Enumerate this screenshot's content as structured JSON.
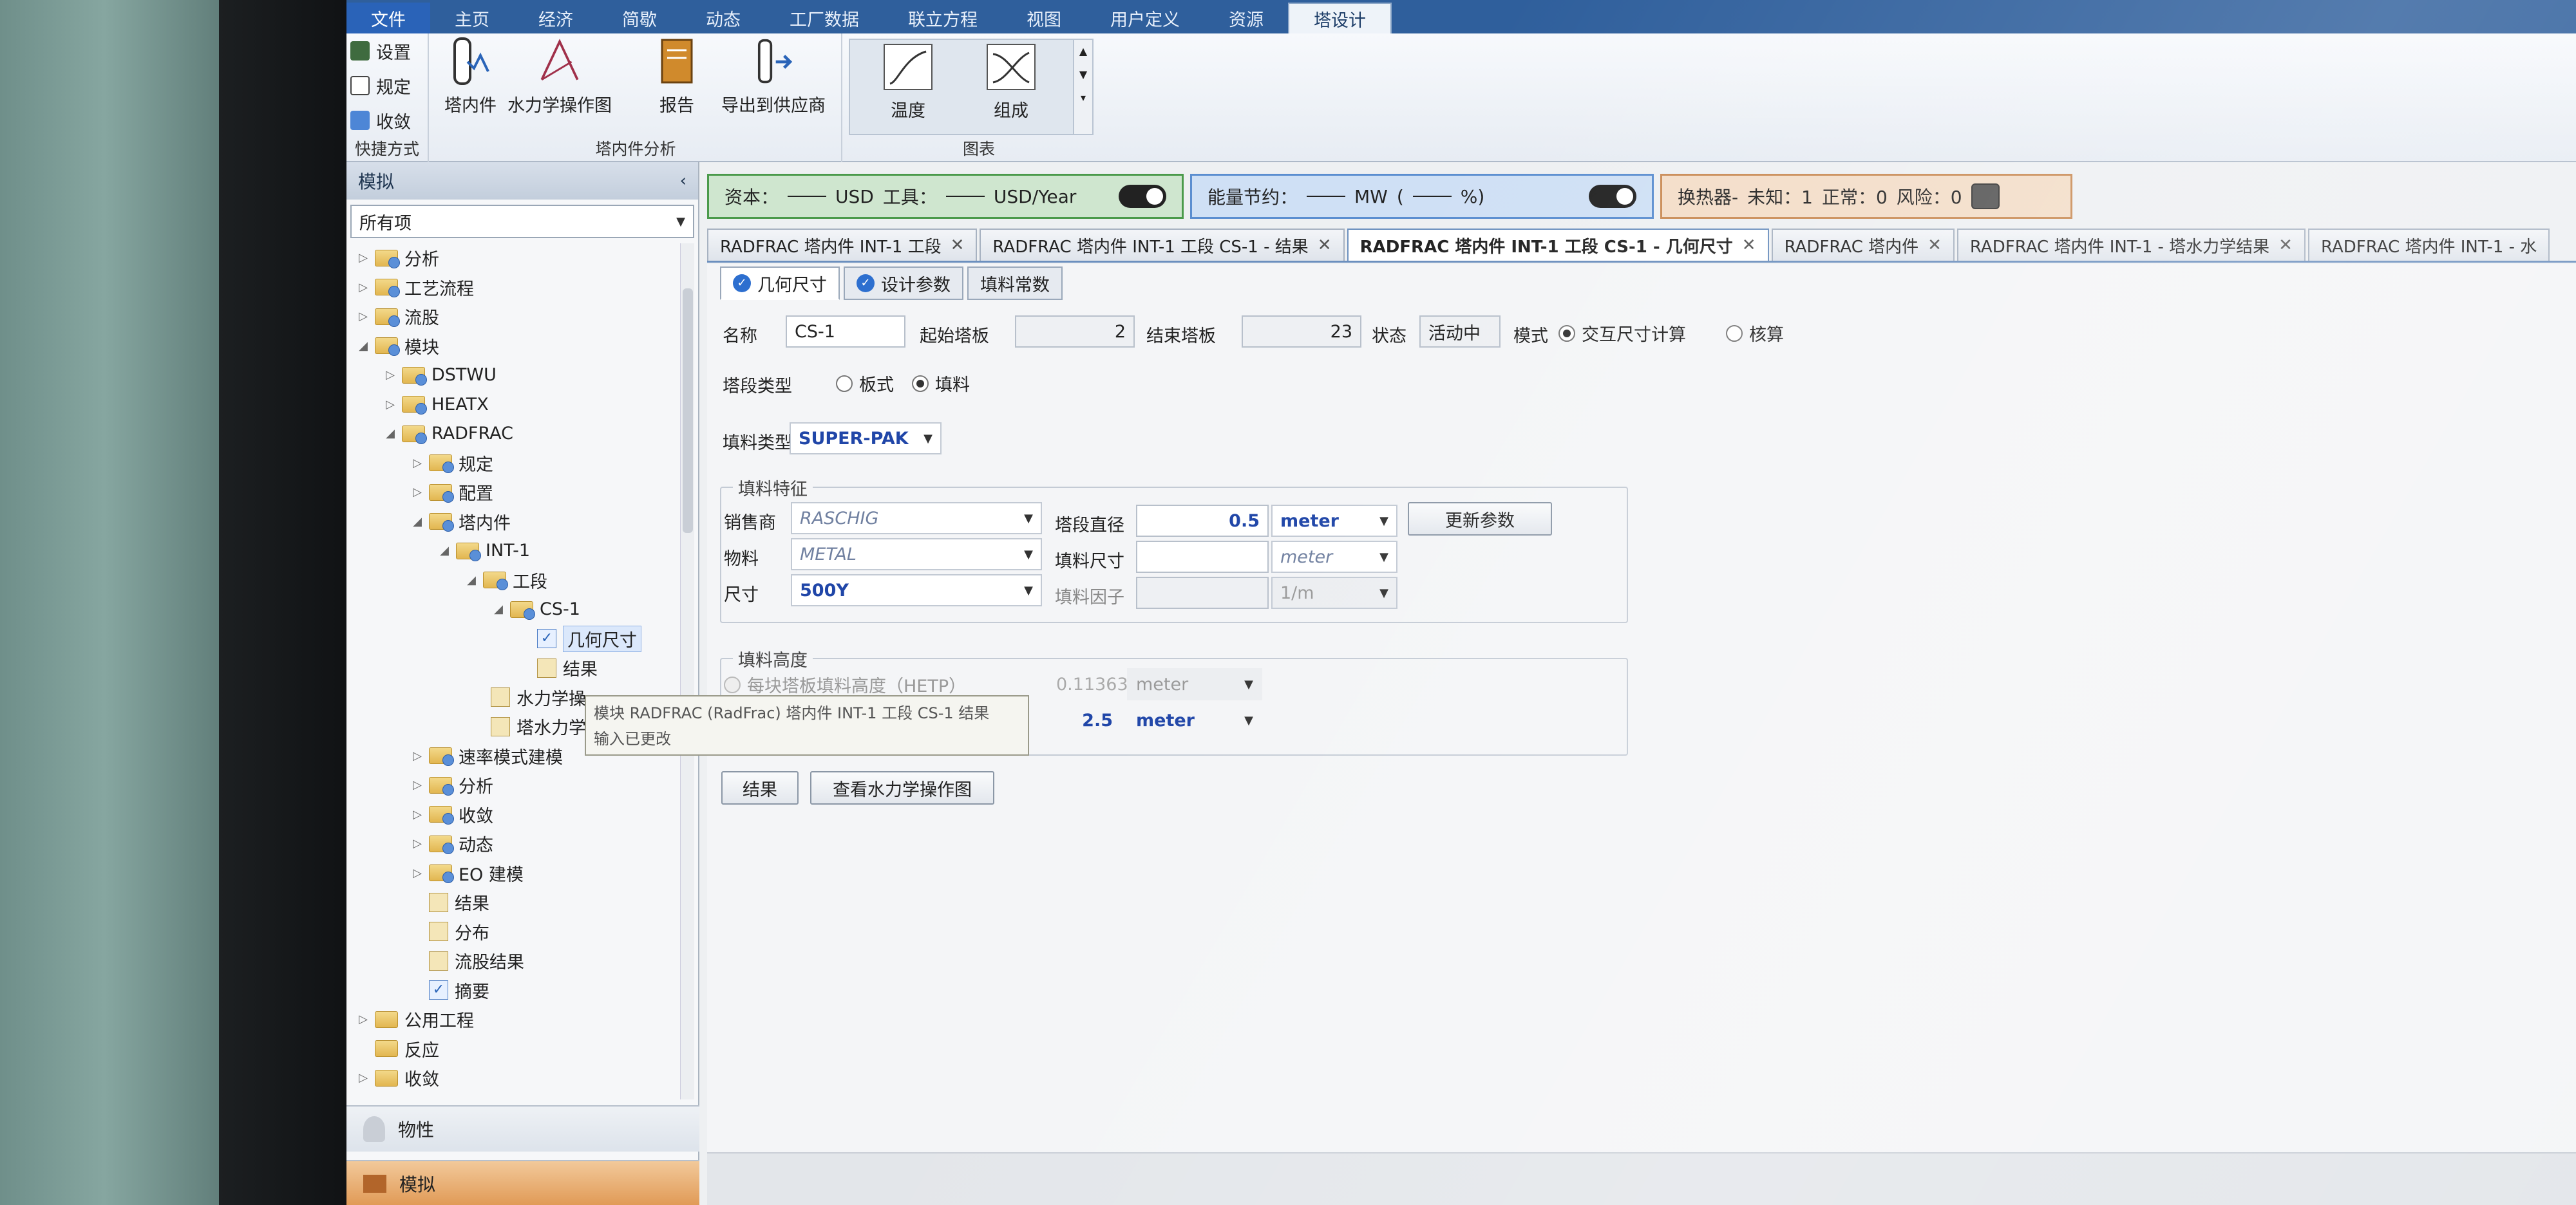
{
  "menu": {
    "tabs": [
      "文件",
      "主页",
      "经济",
      "简歇",
      "动态",
      "工厂数据",
      "联立方程",
      "视图",
      "用户定义",
      "资源",
      "塔设计"
    ],
    "active_tab": "塔设计"
  },
  "ribbon": {
    "quick": {
      "items": [
        "设置",
        "规定",
        "收敛"
      ],
      "group_label": "快捷方式"
    },
    "internals": {
      "buttons": [
        "塔内件",
        "水力学操作图",
        "报告",
        "导出到供应商"
      ],
      "group_label": "塔内件分析"
    },
    "charts": {
      "buttons": [
        "温度",
        "组成"
      ],
      "group_label": "图表"
    }
  },
  "nav": {
    "title": "模拟",
    "filter": "所有项",
    "tree": [
      "分析",
      "工艺流程",
      "流股",
      "模块",
      "DSTWU",
      "HEATX",
      "RADFRAC",
      "规定",
      "配置",
      "塔内件",
      "INT-1",
      "工段",
      "CS-1",
      "几何尺寸",
      "结果",
      "水力学操",
      "塔水力学",
      "速率模式建模",
      "分析",
      "收敛",
      "动态",
      "EO 建模",
      "结果",
      "分布",
      "流股结果",
      "摘要",
      "公用工程",
      "反应",
      "收敛"
    ],
    "bottom": [
      "物性",
      "模拟"
    ]
  },
  "status": {
    "cost_label_capital": "资本：",
    "cost_unit_capital": "USD",
    "cost_label_utility": "工具：",
    "cost_unit_utility": "USD/Year",
    "energy_label": "能量节约：",
    "energy_unit": "MW",
    "energy_pct": "%)",
    "hx_label": "换热器-",
    "hx_unknown": "未知：1",
    "hx_normal": "正常：0",
    "hx_risk": "风险：0"
  },
  "doc_tabs": [
    "RADFRAC 塔内件 INT-1 工段",
    "RADFRAC 塔内件 INT-1 工段 CS-1 - 结果",
    "RADFRAC 塔内件 INT-1 工段 CS-1 - 几何尺寸",
    "RADFRAC 塔内件",
    "RADFRAC 塔内件 INT-1 - 塔水力学结果",
    "RADFRAC 塔内件 INT-1 - 水"
  ],
  "form": {
    "tabs": [
      "几何尺寸",
      "设计参数",
      "填料常数"
    ],
    "name_label": "名称",
    "name_value": "CS-1",
    "start_label": "起始塔板",
    "start_value": "2",
    "end_label": "结束塔板",
    "end_value": "23",
    "state_label": "状态",
    "state_value": "活动中",
    "mode_label": "模式",
    "mode_interactive": "交互尺寸计算",
    "mode_rating": "核算",
    "type_label": "塔段类型",
    "type_tray": "板式",
    "type_packed": "填料",
    "packing_type_label": "填料类型",
    "packing_type_value": "SUPER-PAK",
    "char_group": "填料特征",
    "vendor_label": "销售商",
    "vendor_value": "RASCHIG",
    "material_label": "物料",
    "material_value": "METAL",
    "size_label": "尺寸",
    "size_value": "500Y",
    "diam_label": "塔段直径",
    "diam_value": "0.5",
    "diam_unit": "meter",
    "pack_size_label": "填料尺寸",
    "pack_size_unit": "meter",
    "pack_factor_label": "填料因子",
    "pack_factor_unit": "1/m",
    "update_button": "更新参数",
    "height_group": "填料高度",
    "hetp_label": "每块塔板填料高度（HETP）",
    "hetp_value": "0.113636",
    "hetp_unit": "meter",
    "height_value": "2.5",
    "height_unit": "meter",
    "results_button": "结果",
    "hydraulic_button": "查看水力学操作图"
  },
  "tooltip": {
    "line1": "模块 RADFRAC (RadFrac) 塔内件 INT-1 工段 CS-1 结果",
    "line2": "输入已更改"
  },
  "colors": {
    "ribbon_blue": "#2f5f9c",
    "cost_green": "#4b9a4b",
    "energy_blue": "#5b8ed0",
    "hx_orange": "#c98b55",
    "value_blue": "#2046a8"
  }
}
